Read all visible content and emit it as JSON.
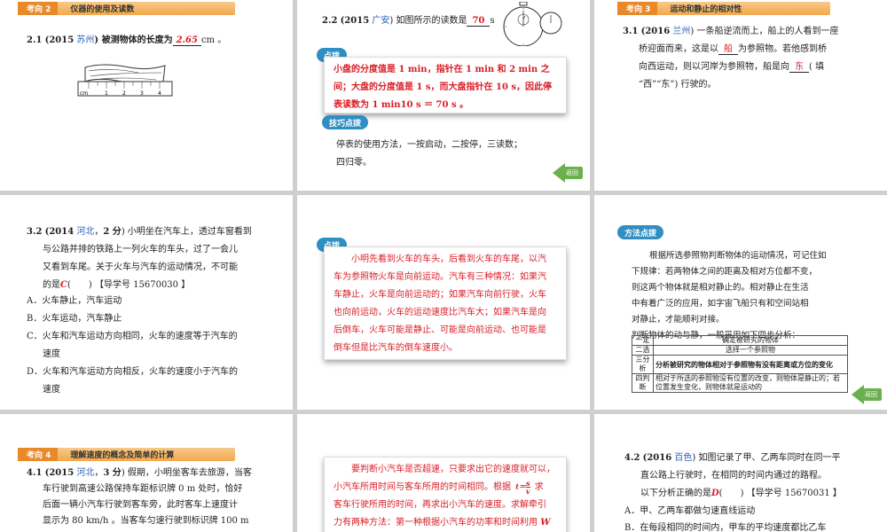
{
  "s1": {
    "tag_num": "考向 2",
    "tag_title": "仪器的使用及读数",
    "q_num": "2.1",
    "q_year": "(2015",
    "q_place": "苏州",
    "q_text_a": ") 被测物体的长度为",
    "q_answer": "2.65",
    "q_text_b": "cm 。",
    "ruler_ticks": [
      "cm",
      "1",
      "2",
      "3",
      "4"
    ]
  },
  "s2": {
    "q_num": "2.2",
    "q_year": "(2015",
    "q_place": "广安",
    "q_text_a": ") 如图所示的读数是",
    "q_answer": "70",
    "q_text_b": "s",
    "pill1": "点拨",
    "expl_lines": [
      "小盘的分度值是 1 min，指针在 1 min 和 2 min 之",
      "间；大盘的分度值是 1 s，而大盘指针在 10 s，因此停",
      "表读数为 1 min10 s ＝ 70 s 。"
    ],
    "pill2": "技巧点拨",
    "tip_lines": [
      "停表的使用方法，一按启动，二按停，三读数；",
      "四归零。"
    ],
    "back": "返回"
  },
  "s3": {
    "tag_num": "考向 3",
    "tag_title": "运动和静止的相对性",
    "q_num": "3.1",
    "q_year": "(2016",
    "q_place": "兰州",
    "q_text_a": ") 一条船逆流而上，船上的人看到一座",
    "line2_a": "桥迎面而来，这是以",
    "ans1": "船",
    "line2_b": "为参照物。若他感到桥",
    "line3_a": "向西运动，则以河岸为参照物，船是向",
    "ans2": "东",
    "line3_b": "( 填",
    "line4": "“西”“东”) 行驶的。"
  },
  "s4": {
    "q_num": "3.2",
    "q_year": "(2014",
    "q_place": "河北",
    "q_score": "2 分",
    "lines": [
      ") 小明坐在汽车上，透过车窗看到",
      "与公路并排的铁路上一列火车的车头，过了一会儿",
      "又看到车尾。关于火车与汽车的运动情况，不可能"
    ],
    "line4_a": "的是",
    "ans": "C",
    "line4_b": "(　　) 【导学号 15670030 】",
    "options": [
      "A．火车静止，汽车运动",
      "B．火车运动，汽车静止",
      "C．火车和汽车运动方向相同，火车的速度等于汽车的",
      "速度",
      "D．火车和汽车运动方向相反，火车的速度小于汽车的",
      "速度"
    ]
  },
  "s5": {
    "pill": "点拨",
    "lines": [
      "小明先看到火车的车头，后看到火车的车尾，以汽",
      "车为参照物火车是向前运动。汽车有三种情况：如果汽",
      "车静止，火车是向前运动的；如果汽车向前行驶，火车",
      "也向前运动，火车的运动速度比汽车大；如果汽车是向",
      "后倒车，火车可能是静止、可能是向前运动、也可能是",
      "倒车但是比汽车的倒车速度小。"
    ]
  },
  "s6": {
    "pill": "方法点拨",
    "lines": [
      "根据所选参照物判断物体的运动情况，可记住如",
      "下规律：若两物体之间的距离及相对方位都不变，",
      "则这两个物体就是相对静止的。相对静止在生活",
      "中有着广泛的应用，如字宙飞船只有和空间站相",
      "对静止，才能顺利对接。",
      "判断物体的动与静，一般采用如下四步分析："
    ],
    "table": [
      [
        "一定",
        "确定被研究的物体"
      ],
      [
        "二选",
        "选择一个参照物"
      ],
      [
        "三分析",
        "分析被研究的物体相对于参照物有没有距离或方位的变化"
      ],
      [
        "四判断",
        "相对于所选的参照物没有位置的改变，则物体是静止的；若位置发生变化，则物体就是运动的"
      ]
    ],
    "back": "返回"
  },
  "s7": {
    "tag_num": "考向 4",
    "tag_title": "理解速度的概念及简单的计算",
    "q_num": "4.1",
    "q_year": "(2015",
    "q_place": "河北",
    "q_score": "3 分",
    "lines": [
      ") 假期，小明坐客车去旅游，当客",
      "车行驶到高速公路保持车距标识牌 0 m 处时，恰好",
      "后面一辆小汽车行驶到客车旁，此时客车上速度计",
      "显示为 80 km/h 。当客车匀速行驶到标识牌 100 m"
    ]
  },
  "s8": {
    "lines": [
      "要判断小汽车是否超速，只要求出它的速度就可以，",
      "小汽车所用时间与客车所用的时间相同。根据",
      "求",
      "客车行驶所用的时间，再求出小汽车的速度。求解牵引",
      "力有两种方法：第一种根据小汽车的功率和时间利用"
    ],
    "formula_v": "v",
    "formula_s": "s",
    "formula_t": "t",
    "w": "W"
  },
  "s9": {
    "q_num": "4.2",
    "q_year": "(2016",
    "q_place": "百色",
    "lines": [
      ") 如图记录了甲、乙两车同时在同一平",
      "直公路上行驶时，在相同的时间内通过的路程。"
    ],
    "line3_a": "以下分析正确的是",
    "ans": "D",
    "line3_b": "(　　) 【导学号 15670031 】",
    "options": [
      "A．甲、乙两车都做匀速直线运动",
      "B．在每段相同的时间内，甲车的平均速度都比乙车"
    ]
  }
}
